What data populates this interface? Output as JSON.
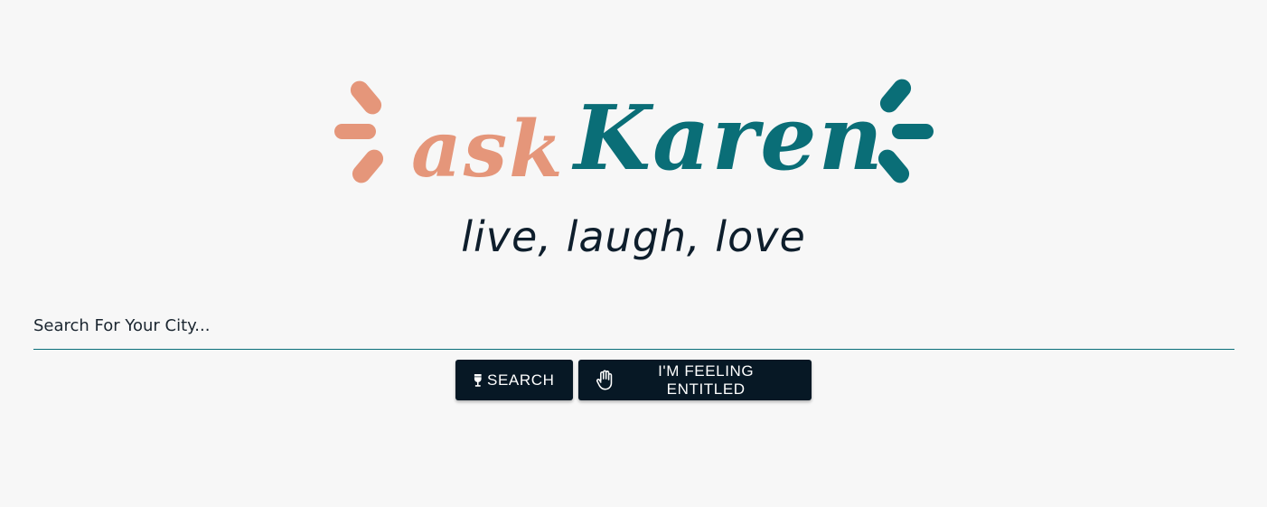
{
  "logo": {
    "ask_text": "ask",
    "name_text": "Karen",
    "accent_color": "#e5967a",
    "brand_color": "#0a6e77"
  },
  "tagline": "live, laugh, love",
  "search": {
    "placeholder": "Search For Your City...",
    "value": ""
  },
  "buttons": {
    "search_label": "SEARCH",
    "search_icon": "wine-glass-icon",
    "entitled_label": "I'M FEELING ENTITLED",
    "entitled_icon": "raised-hand-icon",
    "background_color": "#071825"
  }
}
